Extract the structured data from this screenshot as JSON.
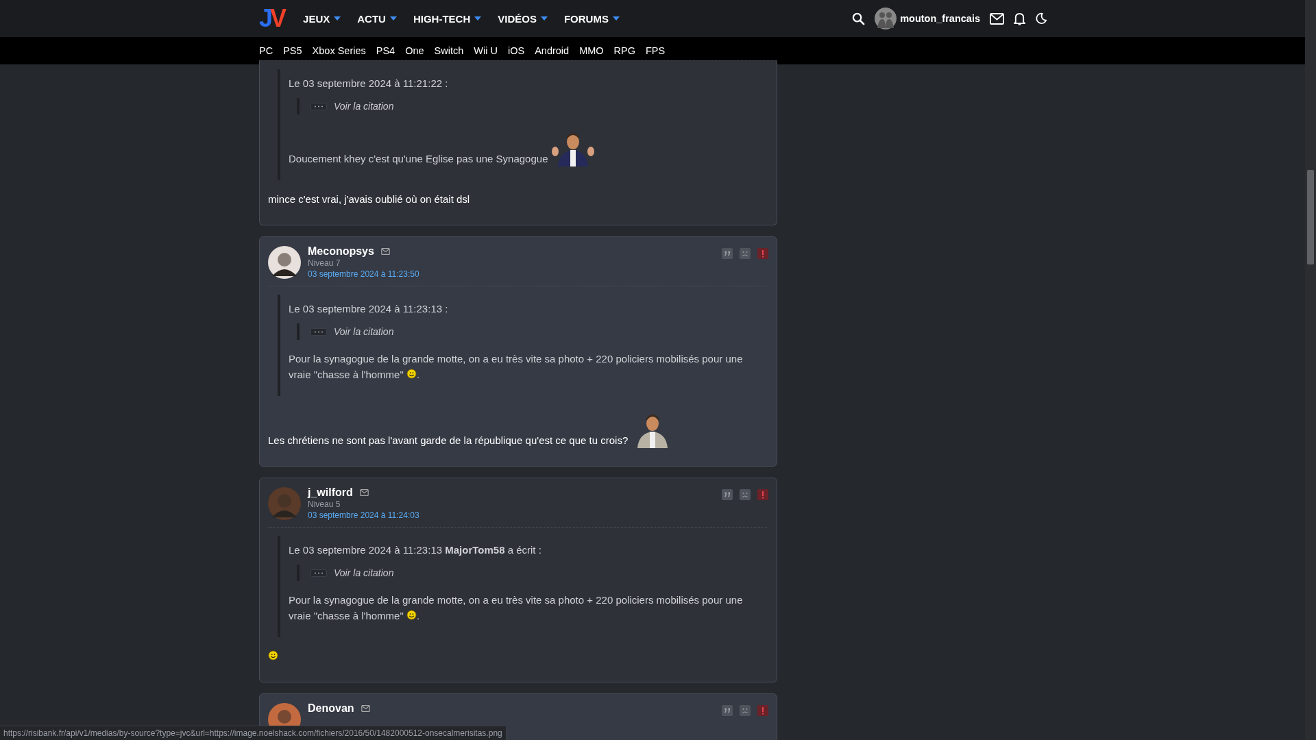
{
  "header": {
    "logo": "JV",
    "nav": [
      {
        "label": "JEUX"
      },
      {
        "label": "ACTU"
      },
      {
        "label": "HIGH-TECH"
      },
      {
        "label": "VIDÉOS"
      },
      {
        "label": "FORUMS"
      }
    ],
    "user": {
      "name": "mouton_francais"
    }
  },
  "platforms": [
    "PC",
    "PS5",
    "Xbox Series",
    "PS4",
    "One",
    "Switch",
    "Wii U",
    "iOS",
    "Android",
    "MMO",
    "RPG",
    "FPS"
  ],
  "posts": [
    {
      "quote": {
        "header": "Le 03 septembre 2024 à 11:21:22 :",
        "collapsed_label": "Voir la citation",
        "paragraphs": [
          [
            {
              "kind": "text",
              "text": "Doucement khey c'est qu'une Eglise pas une Synagogue "
            },
            {
              "kind": "picture"
            }
          ]
        ]
      },
      "paragraphs": [
        [
          {
            "kind": "text",
            "text": "mince c'est vrai, j'avais oublié où on était dsl"
          }
        ]
      ]
    },
    {
      "author": {
        "name": "Meconopsys",
        "level": "Niveau 7",
        "date": "03 septembre 2024 à 11:23:50"
      },
      "quote": {
        "header": "Le 03 septembre 2024 à 11:23:13 :",
        "collapsed_label": "Voir la citation",
        "paragraphs": [
          [
            {
              "kind": "text",
              "text": "Pour la synagogue de la grande motte, on a eu très vite sa photo + 220 policiers mobilisés pour une vraie \"chasse à l'homme\" "
            },
            {
              "kind": "smiley"
            },
            {
              "kind": "text",
              "text": "."
            }
          ]
        ]
      },
      "paragraphs": [
        [
          {
            "kind": "text",
            "text": "Les chrétiens ne sont pas l'avant garde de la république qu'est ce que tu crois? "
          },
          {
            "kind": "picture"
          }
        ]
      ]
    },
    {
      "author": {
        "name": "j_wilford",
        "level": "Niveau 5",
        "date": "03 septembre 2024 à 11:24:03"
      },
      "quote": {
        "header": "Le 03 septembre 2024 à 11:23:13 **MajorTom58** a écrit :",
        "collapsed_label": "Voir la citation",
        "paragraphs": [
          [
            {
              "kind": "text",
              "text": "Pour la synagogue de la grande motte, on a eu très vite sa photo + 220 policiers mobilisés pour une vraie \"chasse à l'homme\" "
            },
            {
              "kind": "smiley"
            },
            {
              "kind": "text",
              "text": "."
            }
          ]
        ]
      },
      "paragraphs": [
        [
          {
            "kind": "smiley"
          }
        ]
      ]
    },
    {
      "author": {
        "name": "Denovan"
      }
    }
  ],
  "status_bar": "https://risibank.fr/api/v1/medias/by-source?type=jvc&url=https://image.noelshack.com/fichiers/2016/50/1482000512-onsecalmerisitas.png"
}
